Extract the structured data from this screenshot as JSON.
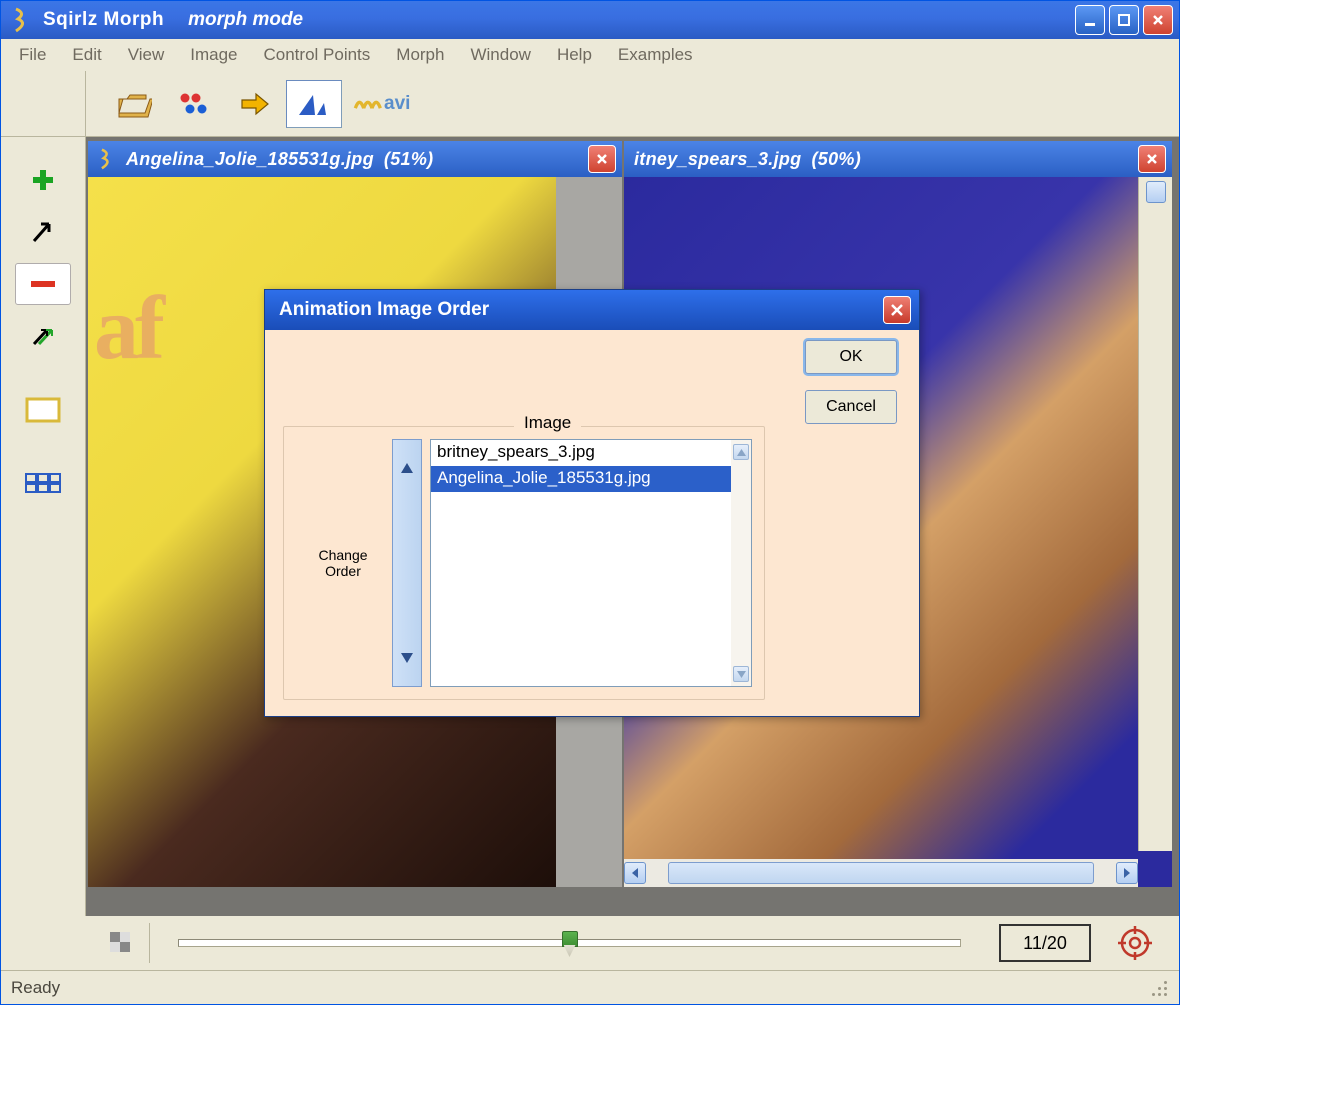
{
  "app": {
    "title": "Sqirlz Morph",
    "mode": "morph mode"
  },
  "menu": [
    "File",
    "Edit",
    "View",
    "Image",
    "Control Points",
    "Morph",
    "Window",
    "Help",
    "Examples"
  ],
  "toolbar": {
    "open_icon": "folder-open-icon",
    "points_icon": "color-dots-icon",
    "arrow_icon": "right-arrow-icon",
    "triangle_icon": "triangles-icon",
    "wave_icon": "wave-icon",
    "avi_label": "avi"
  },
  "sidebar": {
    "add": "plus-icon",
    "arrow": "arrow-icon",
    "remove": "minus-icon",
    "pair": "crossed-arrows-icon",
    "frame": "frame-icon",
    "grid": "grid-icon"
  },
  "docs": [
    {
      "title": "Angelina_Jolie_185531g.jpg",
      "zoom": "(51%)",
      "watermark": "af"
    },
    {
      "title": "itney_spears_3.jpg",
      "zoom": "(50%)"
    }
  ],
  "dialog": {
    "title": "Animation Image Order",
    "ok": "OK",
    "cancel": "Cancel",
    "group_label": "Image",
    "change_label_1": "Change",
    "change_label_2": "Order",
    "items": [
      "britney_spears_3.jpg",
      "Angelina_Jolie_185531g.jpg"
    ],
    "selected_index": 1
  },
  "timeline": {
    "readout": "11/20"
  },
  "status": {
    "text": "Ready"
  }
}
